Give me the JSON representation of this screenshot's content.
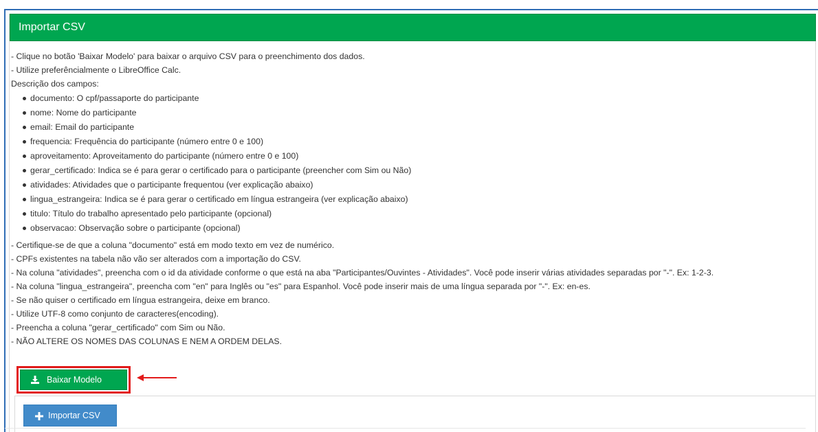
{
  "header": {
    "title": "Importar CSV"
  },
  "instructions": {
    "intro": [
      "- Clique no botão 'Baixar Modelo' para baixar o arquivo CSV para o preenchimento dos dados.",
      "- Utilize preferêncialmente o LibreOffice Calc.",
      "Descrição dos campos:"
    ],
    "fields": [
      "documento: O cpf/passaporte do participante",
      "nome: Nome do participante",
      "email: Email do participante",
      "frequencia: Frequência do participante (número entre 0 e 100)",
      "aproveitamento: Aproveitamento do participante (número entre 0 e 100)",
      "gerar_certificado: Indica se é para gerar o certificado para o participante (preencher com Sim ou Não)",
      "atividades: Atividades que o participante frequentou (ver explicação abaixo)",
      "lingua_estrangeira: Indica se é para gerar o certificado em língua estrangeira (ver explicação abaixo)",
      "titulo: Título do trabalho apresentado pelo participante (opcional)",
      "observacao: Observação sobre o participante (opcional)"
    ],
    "notes": [
      "- Certifique-se de que a coluna \"documento\" está em modo texto em vez de numérico.",
      "- CPFs existentes na tabela não vão ser alterados com a importação do CSV.",
      "- Na coluna \"atividades\", preencha com o id da atividade conforme o que está na aba \"Participantes/Ouvintes - Atividades\". Você pode inserir várias atividades separadas por \"-\". Ex: 1-2-3.",
      "- Na coluna \"lingua_estrangeira\", preencha com \"en\" para Inglês ou \"es\" para Espanhol. Você pode inserir mais de uma língua separada por \"-\". Ex: en-es.",
      "- Se não quiser o certificado em língua estrangeira, deixe em branco.",
      "- Utilize UTF-8 como conjunto de caracteres(encoding).",
      "- Preencha a coluna \"gerar_certificado\" com Sim ou Não.",
      "- NÃO ALTERE OS NOMES DAS COLUNAS E NEM A ORDEM DELAS."
    ]
  },
  "actions": {
    "download_label": "Baixar Modelo",
    "import_label": "Importar CSV"
  },
  "icons": {
    "download": "download-icon",
    "import": "plus-icon",
    "annotation": "arrow-left-icon"
  },
  "colors": {
    "header_green": "#00a650",
    "import_blue": "#428bca",
    "highlight_red": "#e21b1b"
  }
}
